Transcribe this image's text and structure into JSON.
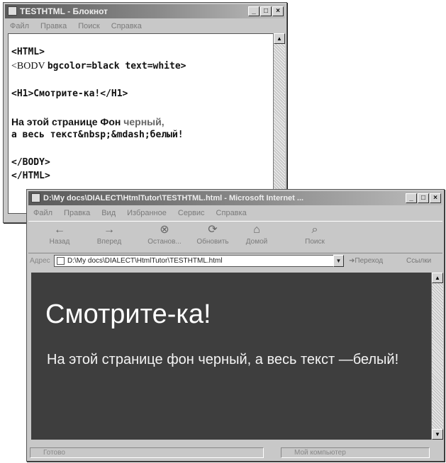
{
  "notepad": {
    "title": "TESTHTML - Блокнот",
    "menu": [
      "Файл",
      "Правка",
      "Поиск",
      "Справка"
    ],
    "lines": {
      "l1": "<HTML>",
      "l2a": "<BODV ",
      "l2b": "bgcolor=black text=white>",
      "l3": "<H1>Смотрите-ка!</H1>",
      "l4a": "На этой странице Фон ",
      "l4b": "черный,",
      "l5": "а весь текст&nbsp;&mdash;белый!",
      "l6": "</BODY>",
      "l7": "</HTML>"
    }
  },
  "ie": {
    "title": "D:\\My docs\\DIALECT\\HtmlTutor\\TESTHTML.html - Microsoft Internet ...",
    "menu": [
      "Файл",
      "Правка",
      "Вид",
      "Избранное",
      "Сервис",
      "Справка"
    ],
    "toolbar": [
      {
        "label": "Назад",
        "icon": "back-arrow-icon"
      },
      {
        "label": "Вперед",
        "icon": "forward-arrow-icon"
      },
      {
        "label": "Останов...",
        "icon": "stop-icon"
      },
      {
        "label": "Обновить",
        "icon": "refresh-icon"
      },
      {
        "label": "Домой",
        "icon": "home-icon"
      },
      {
        "label": "Поиск",
        "icon": "search-icon"
      }
    ],
    "address_label": "Адрес",
    "address_value": "D:\\My docs\\DIALECT\\HtmlTutor\\TESTHTML.html",
    "go_label": "Переход",
    "links_label": "Ссылки",
    "page_heading": "Смотрите-ка!",
    "page_text": "На этой странице фон черный, а весь текст —белый!",
    "status_left": "Готово",
    "status_right": "Мой компьютер"
  }
}
